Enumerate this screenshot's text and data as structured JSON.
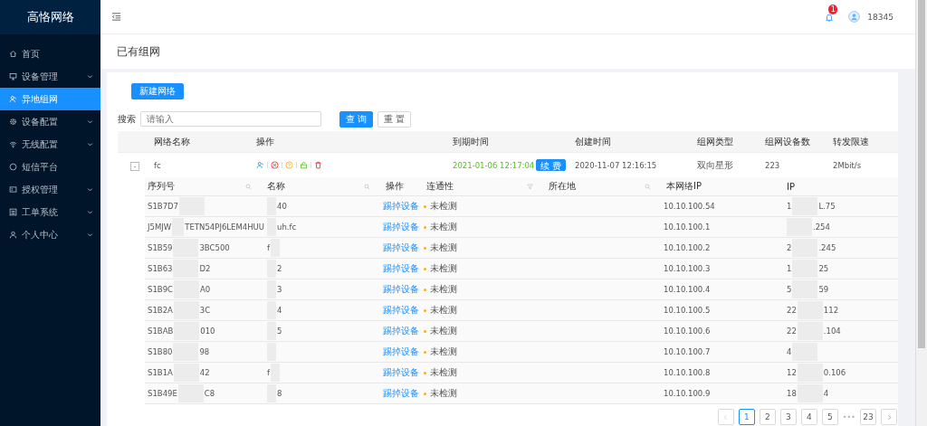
{
  "sidebar": {
    "logo": "高恪网络",
    "items": [
      {
        "label": "首页",
        "expandable": false,
        "selected": false
      },
      {
        "label": "设备管理",
        "expandable": true,
        "selected": false
      },
      {
        "label": "异地组网",
        "expandable": false,
        "selected": true
      },
      {
        "label": "设备配置",
        "expandable": true,
        "selected": false
      },
      {
        "label": "无线配置",
        "expandable": true,
        "selected": false
      },
      {
        "label": "短信平台",
        "expandable": false,
        "selected": false
      },
      {
        "label": "授权管理",
        "expandable": true,
        "selected": false
      },
      {
        "label": "工单系统",
        "expandable": true,
        "selected": false
      },
      {
        "label": "个人中心",
        "expandable": true,
        "selected": false
      }
    ]
  },
  "header": {
    "notification_count": "1",
    "user": "18345"
  },
  "page_title": "已有组网",
  "toolbar": {
    "new_button": "新建网络",
    "search_label": "搜索",
    "search_placeholder": "请输入",
    "query_button": "查 询",
    "reset_button": "重 置"
  },
  "network_table": {
    "columns": [
      "网络名称",
      "操作",
      "到期时间",
      "创建时间",
      "组网类型",
      "组网设备数",
      "转发限速"
    ],
    "rows": [
      {
        "expanded": true,
        "expand_sign": "-",
        "name": "fc",
        "expiry": "2021-01-06 12:17:04",
        "renew_button": "续 费",
        "created": "2020-11-07 12:16:15",
        "type": "双向星形",
        "device_count": "223",
        "speed": "2Mbit/s"
      }
    ]
  },
  "device_table": {
    "columns": [
      "序列号",
      "名称",
      "操作",
      "连通性",
      "所在地",
      "本网络IP",
      "IP"
    ],
    "rows": [
      {
        "serial_start": "S1B7D7",
        "name_end": "40",
        "action": "踢掉设备",
        "status": "未检测",
        "local_ip": "10.10.100.54",
        "ip_start": "1",
        "ip_end": "L.75"
      },
      {
        "serial_start": "J5MJW",
        "serial_end": "TETN54PJ6LEM4HUU",
        "name_end": "uh.fc",
        "action": "踢掉设备",
        "status": "未检测",
        "local_ip": "10.10.100.1",
        "ip_end": ".254"
      },
      {
        "serial_start": "S1B59",
        "serial_end": "3BC500",
        "name_start": "f",
        "action": "踢掉设备",
        "status": "未检测",
        "local_ip": "10.10.100.2",
        "ip_start": "2",
        "ip_end": ".245"
      },
      {
        "serial_start": "S1B63",
        "serial_end": "D2",
        "name_end": "2",
        "action": "踢掉设备",
        "status": "未检测",
        "local_ip": "10.10.100.3",
        "ip_start": "1",
        "ip_end": "25"
      },
      {
        "serial_start": "S1B9C",
        "serial_end": "A0",
        "name_end": "3",
        "action": "踢掉设备",
        "status": "未检测",
        "local_ip": "10.10.100.4",
        "ip_start": "5",
        "ip_end": "59"
      },
      {
        "serial_start": "S1B2A",
        "serial_end": "3C",
        "name_end": "4",
        "action": "踢掉设备",
        "status": "未检测",
        "local_ip": "10.10.100.5",
        "ip_start": "22",
        "ip_end": "112"
      },
      {
        "serial_start": "S1BAB",
        "serial_end": "010",
        "name_end": "5",
        "action": "踢掉设备",
        "status": "未检测",
        "local_ip": "10.10.100.6",
        "ip_start": "22",
        "ip_end": ".104"
      },
      {
        "serial_start": "S1B80",
        "serial_end": "98",
        "action": "踢掉设备",
        "status": "未检测",
        "local_ip": "10.10.100.7",
        "ip_start": "4"
      },
      {
        "serial_start": "S1B1A",
        "serial_end": "42",
        "name_start": "f",
        "action": "踢掉设备",
        "status": "未检测",
        "local_ip": "10.10.100.8",
        "ip_start": "12",
        "ip_end": "0.106"
      },
      {
        "serial_start": "S1B49E",
        "serial_end": "C8",
        "name_end": "8",
        "action": "踢掉设备",
        "status": "未检测",
        "local_ip": "10.10.100.9",
        "ip_start": "18",
        "ip_end": "4"
      }
    ]
  },
  "pagination": {
    "pages": [
      {
        "label": "1",
        "selected": true
      },
      {
        "label": "2",
        "selected": false
      },
      {
        "label": "3",
        "selected": false
      },
      {
        "label": "4",
        "selected": false
      },
      {
        "label": "5",
        "selected": false
      }
    ],
    "ellipsis": "•••",
    "last": "23"
  }
}
